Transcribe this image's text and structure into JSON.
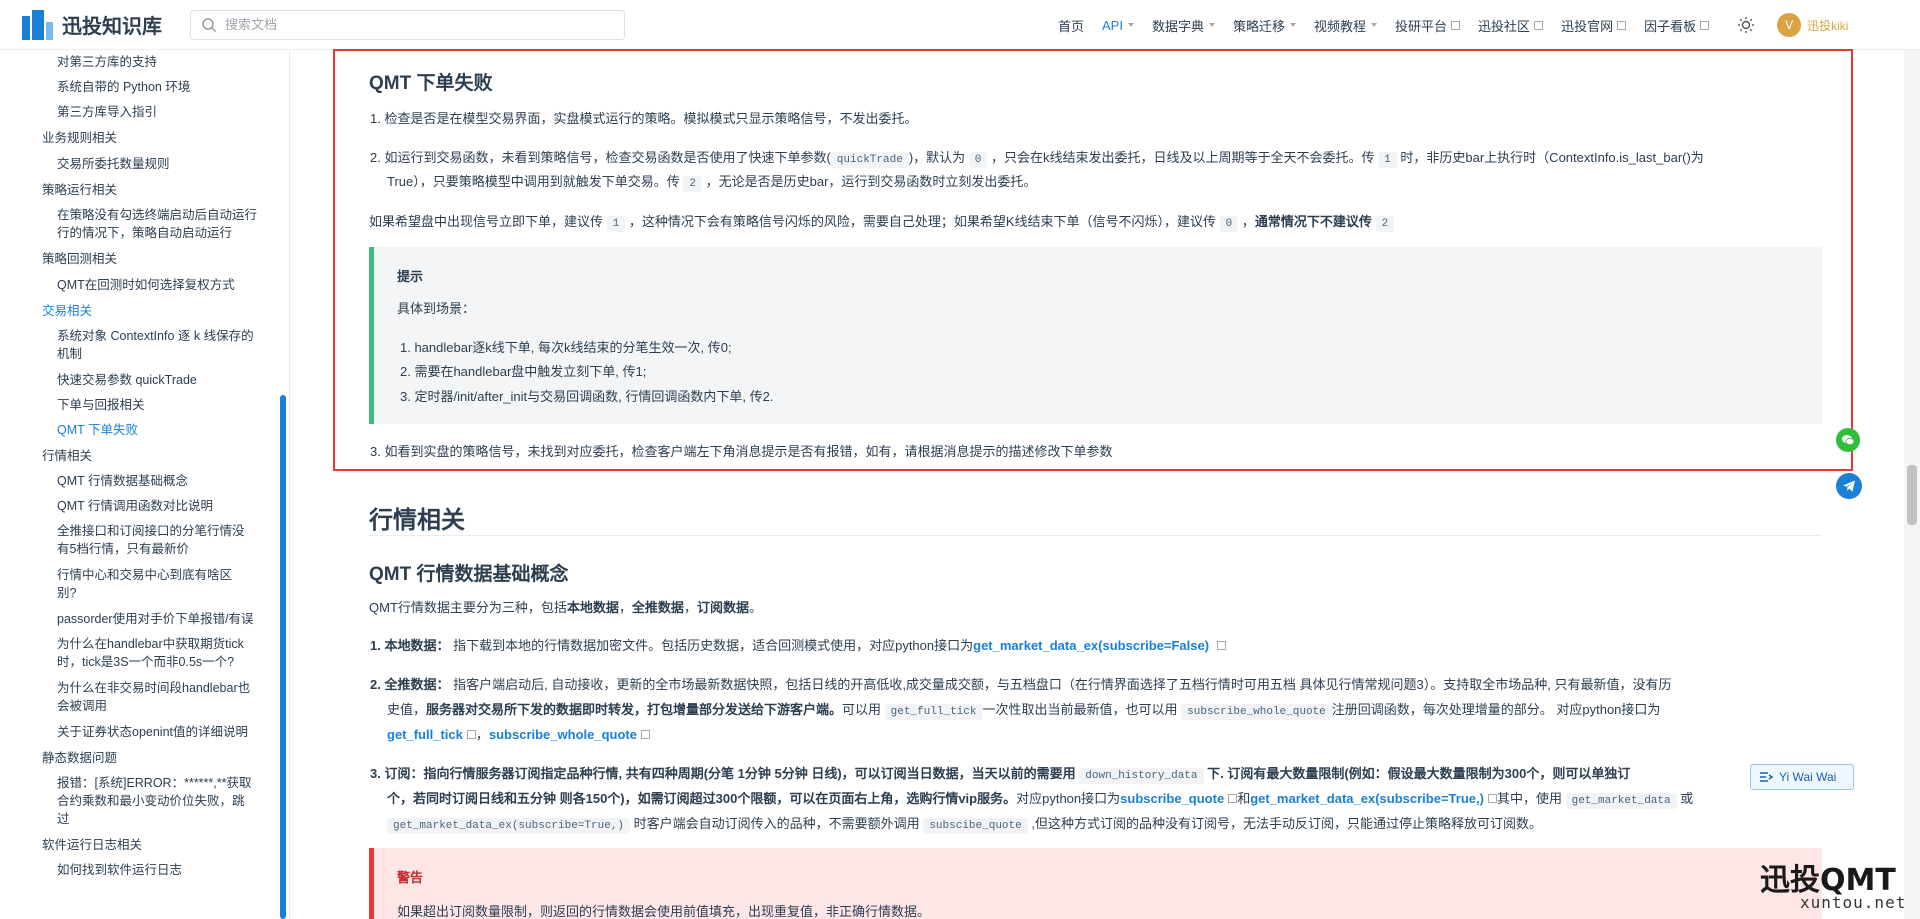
{
  "header": {
    "logo_text": "迅投知识库",
    "search_placeholder": "搜索文档",
    "nav": [
      {
        "label": "首页"
      },
      {
        "label": "API"
      },
      {
        "label": "数据字典"
      },
      {
        "label": "策略迁移"
      },
      {
        "label": "视频教程"
      },
      {
        "label": "投研平台"
      },
      {
        "label": "迅投社区"
      },
      {
        "label": "迅投官网"
      },
      {
        "label": "因子看板"
      }
    ],
    "avatar_letter": "V",
    "username": "迅投kiki"
  },
  "sidebar": {
    "items": [
      "对第三方库的支持",
      "系统自带的 Python 环境",
      "第三方库导入指引",
      "业务规则相关",
      "交易所委托数量规则",
      "策略运行相关",
      "在策略没有勾选终端启动后自动运行",
      "行的情况下，策略自动启动运行",
      "策略回测相关",
      "QMT在回测时如何选择复权方式",
      "交易相关",
      "系统对象 ContextInfo 逐 k 线保存的",
      "机制",
      "快速交易参数 quickTrade",
      "下单与回报相关",
      "QMT 下单失败",
      "行情相关",
      "QMT 行情数据基础概念",
      "QMT 行情调用函数对比说明",
      "全推接口和订阅接口的分笔行情没",
      "有5档行情，只有最新价",
      "行情中心和交易中心到底有啥区",
      "别?",
      "passorder使用对手价下单报错/有误",
      "为什么在handlebar中获取期货tick",
      "时，tick是3S一个而非0.5s一个?",
      "为什么在非交易时间段handlebar也",
      "会被调用",
      "关于证券状态openint值的详细说明",
      "静态数据问题",
      "报错：[系统]ERROR：******,**获取",
      "合约乘数和最小变动价位失败，跳",
      "过",
      "软件运行日志相关",
      "如何找到软件运行日志"
    ]
  },
  "content": {
    "s1_title": "QMT 下单失败",
    "s1_item1": "1. 检查是否是在模型交易界面，实盘模式运行的策略。模拟模式只显示策略信号，不发出委托。",
    "s1_item2_a": "2. 如运行到交易函数，未看到策略信号，检查交易函数是否使用了快速下单参数(",
    "s1_item2_code1": "quickTrade",
    "s1_item2_b": ")，默认为",
    "s1_item2_code2": "0",
    "s1_item2_c": "，只会在k线结束发出委托，日线及以上周期等于全天不会委托。传",
    "s1_item2_code3": "1",
    "s1_item2_d": "时，非历史bar上执行时（ContextInfo.is_last_bar()为",
    "s1_item2_e": "True），只要策略模型中调用到就触发下单交易。传",
    "s1_item2_code4": "2",
    "s1_item2_f": "，无论是否是历史bar，运行到交易函数时立刻发出委托。",
    "s1_para_a": "如果希望盘中出现信号立即下单，建议传",
    "s1_para_code1": "1",
    "s1_para_b": "，这种情况下会有策略信号闪烁的风险，需要自己处理；如果希望K线结束下单（信号不闪烁），建议传",
    "s1_para_code2": "0",
    "s1_para_c": "，",
    "s1_para_bold": "通常情况下不建议传",
    "s1_para_code3": "2",
    "tip_title": "提示",
    "tip_sub": "具体到场景：",
    "tip_1": "1. handlebar逐k线下单, 每次k线结束的分笔生效一次, 传0;",
    "tip_2": "2. 需要在handlebar盘中触发立刻下单, 传1;",
    "tip_3": "3. 定时器/init/after_init与交易回调函数, 行情回调函数内下单, 传2.",
    "s1_item3": "3. 如看到实盘的策略信号，未找到对应委托，检查客户端左下角消息提示是否有报错，如有，请根据消息提示的描述修改下单参数",
    "h2": "行情相关",
    "s2_title": "QMT 行情数据基础概念",
    "s2_intro_a": "QMT行情数据主要分为三种，包括",
    "s2_intro_b1": "本地数据",
    "s2_intro_c": "，",
    "s2_intro_b2": "全推数据",
    "s2_intro_d": "，",
    "s2_intro_b3": "订阅数据",
    "s2_intro_e": "。",
    "s2_1_label": "1. 本地数据：",
    "s2_1_text": "指下载到本地的行情数据加密文件。包括历史数据，适合回测模式使用，对应python接口为",
    "s2_1_link": "get_market_data_ex(subscribe=False)",
    "s2_2_label": "2. 全推数据：",
    "s2_2_text_a": "指客户端启动后, 自动接收，更新的全市场最新数据快照，包括日线的开高低收,成交量成交额，与五档盘口（在行情界面选择了五档行情时可用五档 具体见行情常规问题3）。支持取全市场品种, 只有最新值，没有历",
    "s2_2_text_b": "史值，",
    "s2_2_bold": "服务器对交易所下发的数据即时转发，打包增量部分发送给下游客户端。",
    "s2_2_text_c": "可以用",
    "s2_2_code1": "get_full_tick",
    "s2_2_text_d": "一次性取出当前最新值，也可以用",
    "s2_2_code2": "subscribe_whole_quote",
    "s2_2_text_e": "注册回调函数，每次处理增量的部分。 对应python接口为",
    "s2_2_link1": "get_full_tick",
    "s2_2_link_sep": "，",
    "s2_2_link2": "subscribe_whole_quote",
    "s2_3_label": "3. 订阅：",
    "s2_3_bold_a": "指向行情服务器订阅指定品种行情, 共有四种周期(分笔 1分钟 5分钟 日线)，可以订阅当日数据，当天以前的需要用",
    "s2_3_code1": "down_history_data",
    "s2_3_bold_b": "下. 订阅有最大数量限制(例如：假设最大数量限制为300个，则可以单独订",
    "s2_3_bold_c": "个，若同时订阅日线和五分钟 则各150个)，如需订阅超过300个限额，可以在页面右上角，选购行情vip服务。",
    "s2_3_text_a": "对应python接口为",
    "s2_3_link1": "subscribe_quote",
    "s2_3_text_b": "和",
    "s2_3_link2": "get_market_data_ex(subscribe=True,)",
    "s2_3_text_c": "其中，使用",
    "s2_3_code2": "get_market_data",
    "s2_3_text_d": "或",
    "s2_3_code3": "get_market_data_ex(subscribe=True,)",
    "s2_3_text_e": "时客户端会自动订阅传入的品种，不需要额外调用",
    "s2_3_code4": "subscibe_quote",
    "s2_3_text_f": ",但这种方式订阅的品种没有订阅号，无法手动反订阅，只能通过停止策略释放可订阅数。",
    "warn_title": "警告",
    "warn_text": "如果超出订阅数量限制，则返回的行情数据会使用前值填充，出现重复值，非正确行情数据。"
  },
  "widgets": {
    "yiwai_label": "Yi Wai Wai",
    "watermark": "迅投QMT",
    "watermark_sub": "xuntou.net"
  }
}
